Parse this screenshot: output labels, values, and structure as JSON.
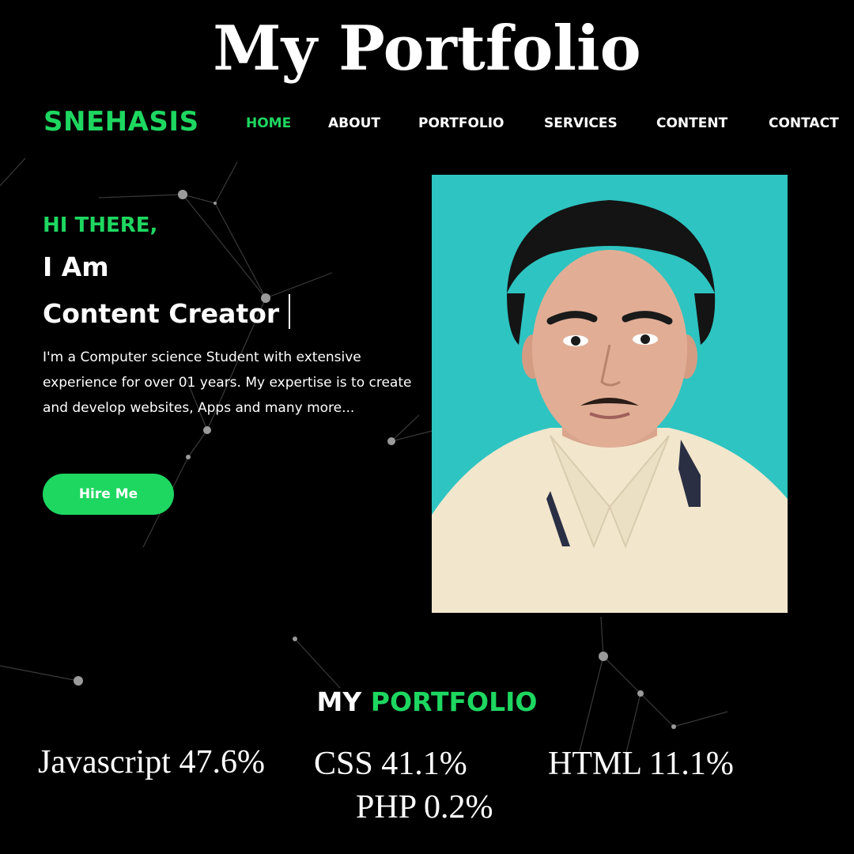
{
  "banner": {
    "title": "My Portfolio"
  },
  "nav": {
    "brand": "SNEHASIS",
    "links": [
      "HOME",
      "ABOUT",
      "PORTFOLIO",
      "SERVICES",
      "CONTENT",
      "CONTACT"
    ],
    "active": "HOME"
  },
  "hero": {
    "greeting": "HI THERE,",
    "line1": "I Am",
    "line2": "Content Creator",
    "description": "I'm a Computer science Student with extensive experience for over 01 years. My expertise is to create and develop websites, Apps and many more...",
    "cta_label": "Hire Me"
  },
  "portfolio": {
    "title_part1": "MY",
    "title_part2": "PORTFOLIO"
  },
  "languages": [
    {
      "label": "Javascript 47.6%"
    },
    {
      "label": "CSS 41.1%"
    },
    {
      "label": "HTML 11.1%"
    },
    {
      "label": "PHP 0.2%"
    }
  ],
  "colors": {
    "accent": "#1ed760",
    "background": "#000000",
    "photo_background": "#2ec4c1"
  }
}
